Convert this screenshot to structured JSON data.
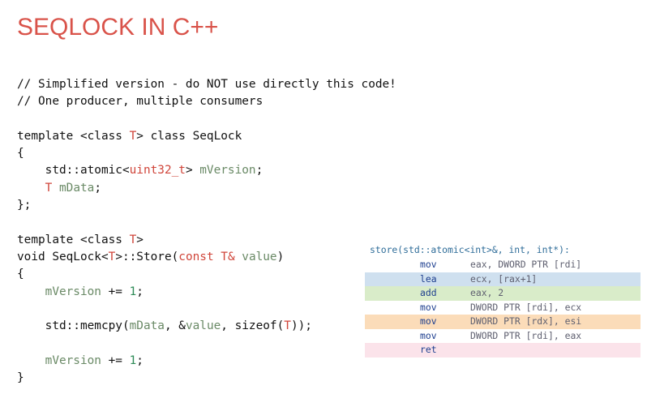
{
  "slide": {
    "title": "SEQLOCK IN C++"
  },
  "code": {
    "lines": [
      [
        {
          "t": "// Simplified version - do NOT use directly this code!",
          "c": ""
        }
      ],
      [
        {
          "t": "// One producer, multiple consumers",
          "c": ""
        }
      ],
      [
        {
          "t": "",
          "c": ""
        }
      ],
      [
        {
          "t": "template <class ",
          "c": ""
        },
        {
          "t": "T",
          "c": "red"
        },
        {
          "t": "> class SeqLock",
          "c": ""
        }
      ],
      [
        {
          "t": "{",
          "c": ""
        }
      ],
      [
        {
          "t": "    std::atomic<",
          "c": ""
        },
        {
          "t": "uint32_t",
          "c": "red"
        },
        {
          "t": "> ",
          "c": ""
        },
        {
          "t": "mVersion",
          "c": "var"
        },
        {
          "t": ";",
          "c": ""
        }
      ],
      [
        {
          "t": "    ",
          "c": ""
        },
        {
          "t": "T",
          "c": "red"
        },
        {
          "t": " ",
          "c": ""
        },
        {
          "t": "mData",
          "c": "var"
        },
        {
          "t": ";",
          "c": ""
        }
      ],
      [
        {
          "t": "};",
          "c": ""
        }
      ],
      [
        {
          "t": "",
          "c": ""
        }
      ],
      [
        {
          "t": "template <class ",
          "c": ""
        },
        {
          "t": "T",
          "c": "red"
        },
        {
          "t": ">",
          "c": ""
        }
      ],
      [
        {
          "t": "void SeqLock<",
          "c": ""
        },
        {
          "t": "T",
          "c": "red"
        },
        {
          "t": ">::Store(",
          "c": ""
        },
        {
          "t": "const T&",
          "c": "red"
        },
        {
          "t": " ",
          "c": ""
        },
        {
          "t": "value",
          "c": "var"
        },
        {
          "t": ")",
          "c": ""
        }
      ],
      [
        {
          "t": "{",
          "c": ""
        }
      ],
      [
        {
          "t": "    ",
          "c": ""
        },
        {
          "t": "mVersion",
          "c": "var"
        },
        {
          "t": " += ",
          "c": ""
        },
        {
          "t": "1",
          "c": "num"
        },
        {
          "t": ";",
          "c": ""
        }
      ],
      [
        {
          "t": "",
          "c": ""
        }
      ],
      [
        {
          "t": "    std::memcpy(",
          "c": ""
        },
        {
          "t": "mData",
          "c": "var"
        },
        {
          "t": ", &",
          "c": ""
        },
        {
          "t": "value",
          "c": "var"
        },
        {
          "t": ", sizeof(",
          "c": ""
        },
        {
          "t": "T",
          "c": "red"
        },
        {
          "t": "));",
          "c": ""
        }
      ],
      [
        {
          "t": "",
          "c": ""
        }
      ],
      [
        {
          "t": "    ",
          "c": ""
        },
        {
          "t": "mVersion",
          "c": "var"
        },
        {
          "t": " += ",
          "c": ""
        },
        {
          "t": "1",
          "c": "num"
        },
        {
          "t": ";",
          "c": ""
        }
      ],
      [
        {
          "t": "}",
          "c": ""
        }
      ]
    ]
  },
  "assembly": {
    "header": "store(std::atomic<int>&, int, int*):",
    "rows": [
      {
        "op": "mov",
        "args": "eax, DWORD PTR [rdi]",
        "bg": "#ffffff"
      },
      {
        "op": "lea",
        "args": "ecx, [rax+1]",
        "bg": "#cfe0ef"
      },
      {
        "op": "add",
        "args": "eax, 2",
        "bg": "#d9ecc9"
      },
      {
        "op": "mov",
        "args": "DWORD PTR [rdi], ecx",
        "bg": "#ffffff"
      },
      {
        "op": "mov",
        "args": "DWORD PTR [rdx], esi",
        "bg": "#fbdcb9"
      },
      {
        "op": "mov",
        "args": "DWORD PTR [rdi], eax",
        "bg": "#ffffff"
      },
      {
        "op": "ret",
        "args": "",
        "bg": "#fbe3ea"
      }
    ]
  },
  "colors": {
    "title": "#d9534a",
    "keyword_red": "#d0463b",
    "variable": "#6a8a66",
    "number": "#2e8b57",
    "asm_header": "#2f6d99",
    "asm_opcode": "#1e3f8f"
  }
}
